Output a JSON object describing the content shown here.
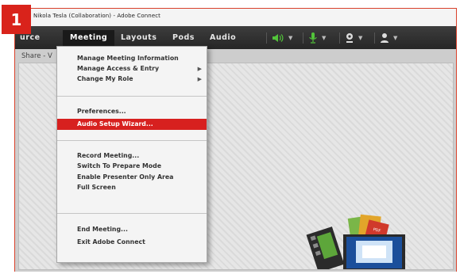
{
  "step_number": "1",
  "window": {
    "title": "Nikola Tesla (Collaboration) - Adobe Connect"
  },
  "menubar": {
    "items": [
      {
        "label": "urce",
        "active": false
      },
      {
        "label": "Meeting",
        "active": true
      },
      {
        "label": "Layouts",
        "active": false
      },
      {
        "label": "Pods",
        "active": false
      },
      {
        "label": "Audio",
        "active": false
      }
    ],
    "tools": [
      {
        "icon": "speaker-icon",
        "color": "#52c43a"
      },
      {
        "icon": "microphone-icon",
        "color": "#52c43a"
      },
      {
        "icon": "webcam-icon",
        "color": "#dddddd"
      },
      {
        "icon": "user-status-icon",
        "color": "#dddddd"
      }
    ]
  },
  "share_pod": {
    "title": "Share - V"
  },
  "meeting_menu": {
    "group1": [
      {
        "label": "Manage Meeting Information",
        "submenu": false
      },
      {
        "label": "Manage Access & Entry",
        "submenu": true
      },
      {
        "label": "Change My Role",
        "submenu": true
      }
    ],
    "group2": [
      {
        "label": "Preferences...",
        "submenu": false
      },
      {
        "label": "Audio Setup Wizard...",
        "submenu": false,
        "highlighted": true
      }
    ],
    "group3": [
      {
        "label": "Record Meeting...",
        "submenu": false
      },
      {
        "label": "Switch To Prepare Mode",
        "submenu": false
      },
      {
        "label": "Enable Presenter Only Area",
        "submenu": false
      },
      {
        "label": "Full Screen",
        "submenu": false
      }
    ],
    "group4": [
      {
        "label": "End Meeting...",
        "submenu": false
      },
      {
        "label": "Exit Adobe Connect",
        "submenu": false
      }
    ],
    "submenu_arrow": "▶"
  },
  "colors": {
    "accent": "#d7201f",
    "menubar": "#2e2e2e"
  }
}
